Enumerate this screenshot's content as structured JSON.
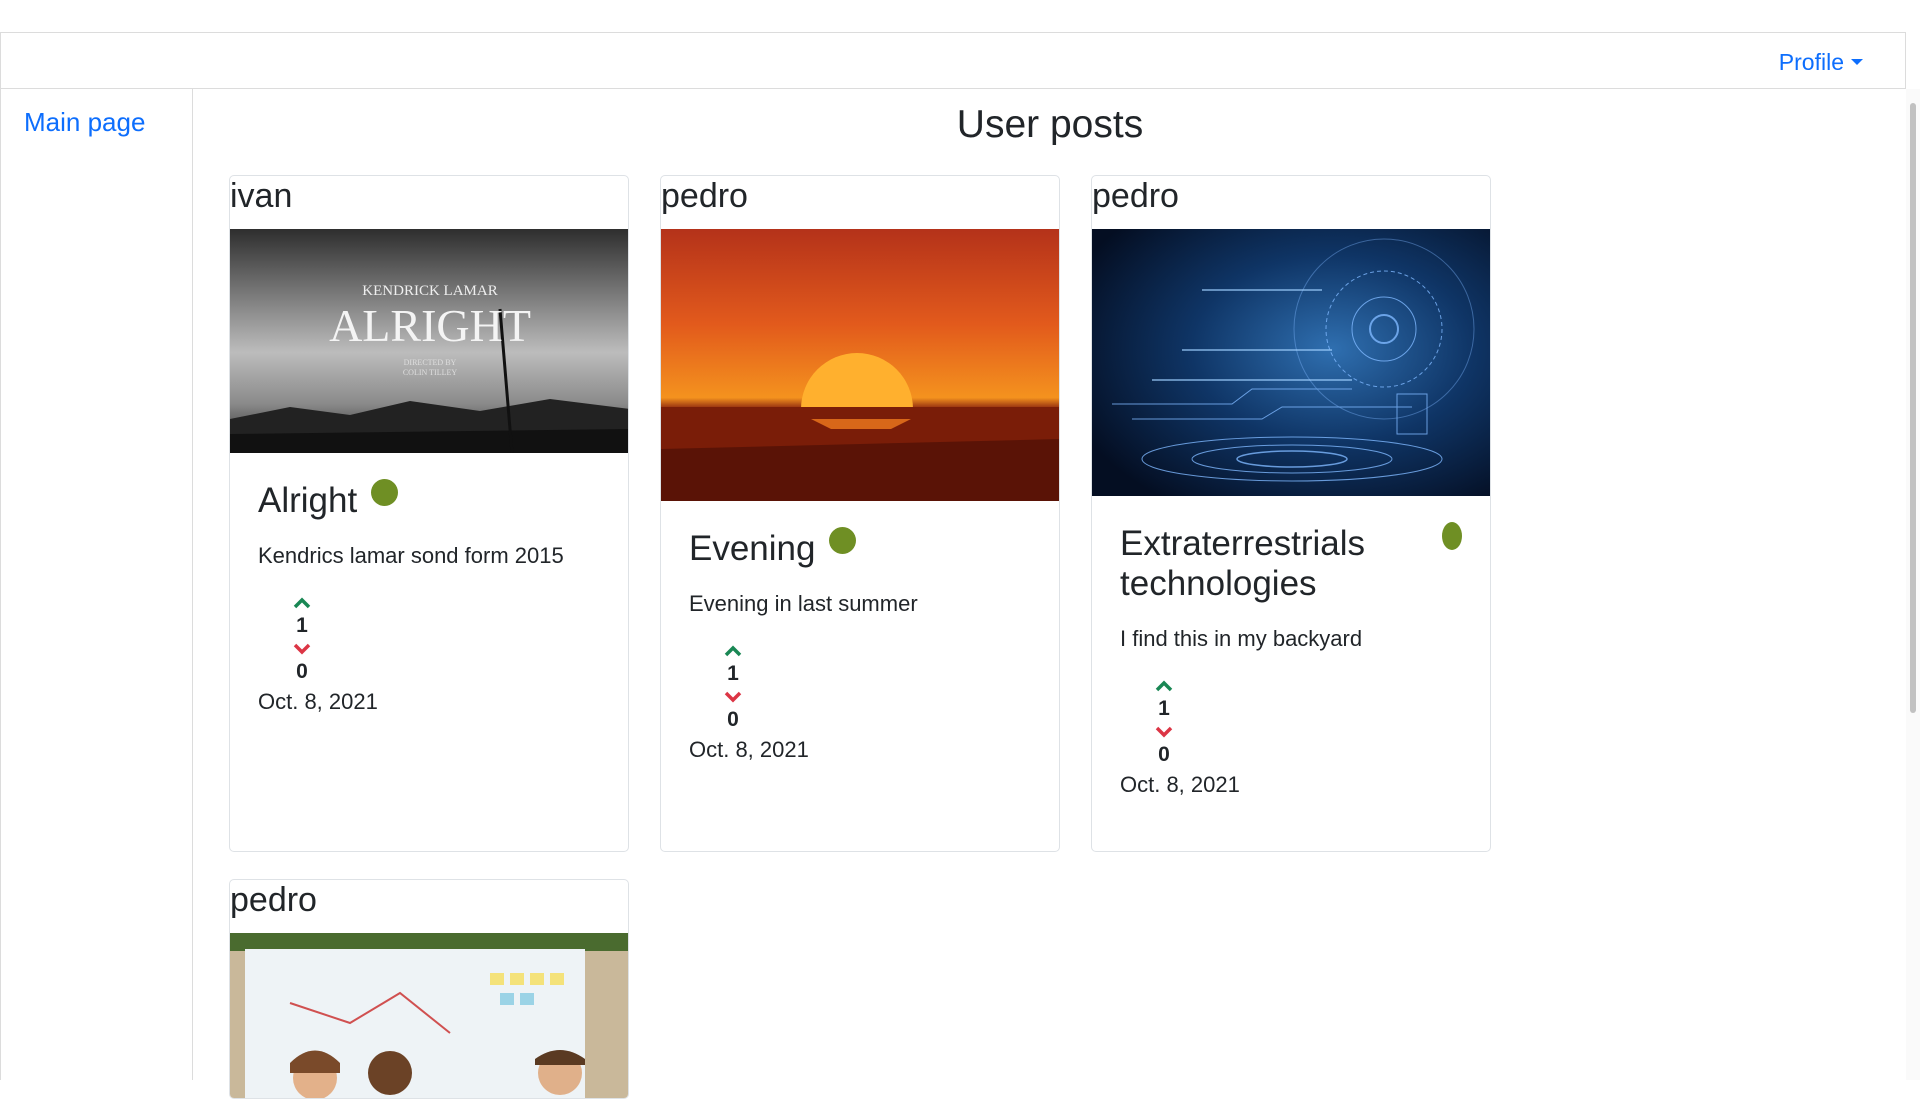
{
  "nav": {
    "profile_label": "Profile"
  },
  "sidebar": {
    "main_page_label": "Main page"
  },
  "page_title": "User posts",
  "posts": [
    {
      "author": "ivan",
      "title": "Alright",
      "description": "Kendrics lamar sond form 2015",
      "upvotes": "1",
      "downvotes": "0",
      "date": "Oct. 8, 2021",
      "image_text": {
        "line1": "KENDRICK LAMAR",
        "line2": "ALRIGHT",
        "line3": "DIRECTED BY",
        "line4": "COLIN TILLEY"
      }
    },
    {
      "author": "pedro",
      "title": "Evening",
      "description": "Evening in last summer",
      "upvotes": "1",
      "downvotes": "0",
      "date": "Oct. 8, 2021"
    },
    {
      "author": "pedro",
      "title": "Extraterrestrials technologies",
      "description": "I find this in my backyard",
      "upvotes": "1",
      "downvotes": "0",
      "date": "Oct. 8, 2021"
    },
    {
      "author": "pedro"
    }
  ],
  "colors": {
    "link": "#0d6efd",
    "status_dot": "#6f8f24",
    "upvote": "#198754",
    "downvote": "#dc3545"
  }
}
